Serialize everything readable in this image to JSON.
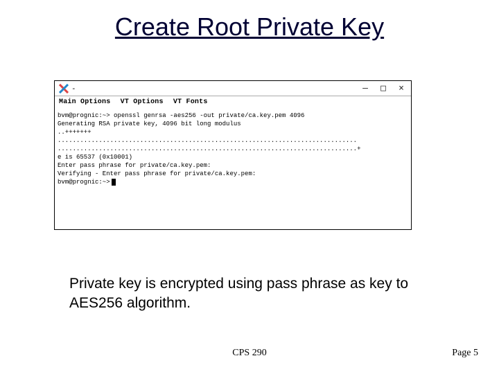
{
  "title": "Create Root Private Key",
  "terminal": {
    "title_suffix": "-",
    "win_min": "—",
    "win_max": "□",
    "win_close": "×",
    "menu": {
      "main": "Main Options",
      "vtopt": "VT Options",
      "vtfonts": "VT Fonts"
    },
    "lines": {
      "l1": "bvm@prognic:~> openssl genrsa -aes256 -out private/ca.key.pem 4096",
      "l2": "Generating RSA private key, 4096 bit long modulus",
      "l3": "..+++++++",
      "l4": "................................................................................",
      "l5": "................................................................................+",
      "l6": "e is 65537 (0x10001)",
      "l7": "Enter pass phrase for private/ca.key.pem:",
      "l8": "Verifying - Enter pass phrase for private/ca.key.pem:",
      "l9": "bvm@prognic:~>"
    }
  },
  "caption": "Private key is encrypted using pass phrase as key to AES256 algorithm.",
  "footer_center": "CPS 290",
  "footer_right": "Page 5"
}
